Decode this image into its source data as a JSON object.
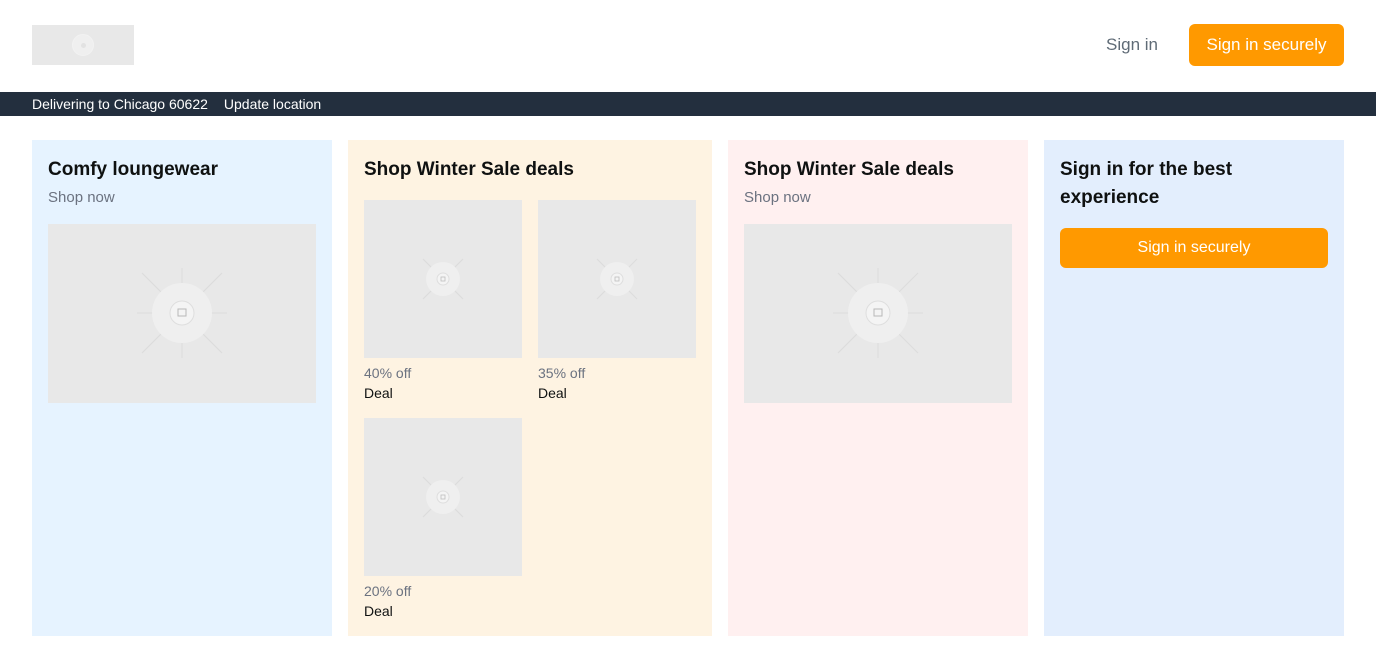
{
  "header": {
    "logo_icon": "image-placeholder-icon",
    "signin_link": "Sign in",
    "signin_button": "Sign in securely"
  },
  "location_bar": {
    "delivering_text": "Delivering to Chicago 60622",
    "update_link": "Update location"
  },
  "cards": [
    {
      "title": "Comfy loungewear",
      "link": "Shop now"
    },
    {
      "title": "Shop Winter Sale deals",
      "deals": [
        {
          "discount": "40% off",
          "label": "Deal"
        },
        {
          "discount": "35% off",
          "label": "Deal"
        },
        {
          "discount": "20% off",
          "label": "Deal"
        }
      ]
    },
    {
      "title": "Shop Winter Sale deals",
      "link": "Shop now"
    },
    {
      "title": "Sign in for the best experience",
      "button": "Sign in securely"
    }
  ],
  "colors": {
    "accent": "#ff9900",
    "nav_bar": "#232f3e",
    "card_blue": "#e6f3ff",
    "card_cream": "#fef3e2",
    "card_pink": "#fff0f0",
    "card_signin": "#e3eefd",
    "placeholder": "#e8e8e8"
  }
}
